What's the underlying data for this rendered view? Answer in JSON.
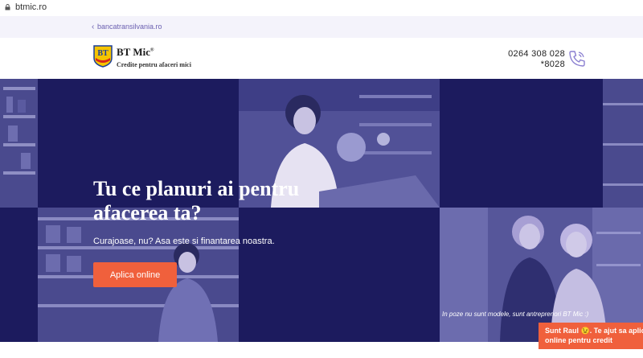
{
  "browser": {
    "url": "btmic.ro"
  },
  "breadcrumb": {
    "back_glyph": "‹",
    "link": "bancatransilvania.ro"
  },
  "header": {
    "logo_letters": "BT",
    "brand": "BT Mic",
    "brand_mark": "®",
    "tagline": "Credite pentru afaceri mici",
    "phone": "0264 308 028",
    "short_phone": "*8028"
  },
  "hero": {
    "headline_line1": "Tu ce planuri ai pentru",
    "headline_line2": "afacerea ta?",
    "subtitle": "Curajoase, nu? Asa este si finantarea noastra.",
    "cta": "Aplica online",
    "caption": "In poze nu sunt modele, sunt antreprenori BT Mic :)"
  },
  "chat": {
    "line1": "Sunt Raul",
    "emoji": "😉",
    "line1_rest": ". Te ajut sa aplici",
    "line2": "online pentru credit"
  },
  "colors": {
    "navy": "#1c1b5e",
    "accent": "#f0603c",
    "link": "#6a5fb0",
    "photo_tint": "#4e4e94"
  }
}
